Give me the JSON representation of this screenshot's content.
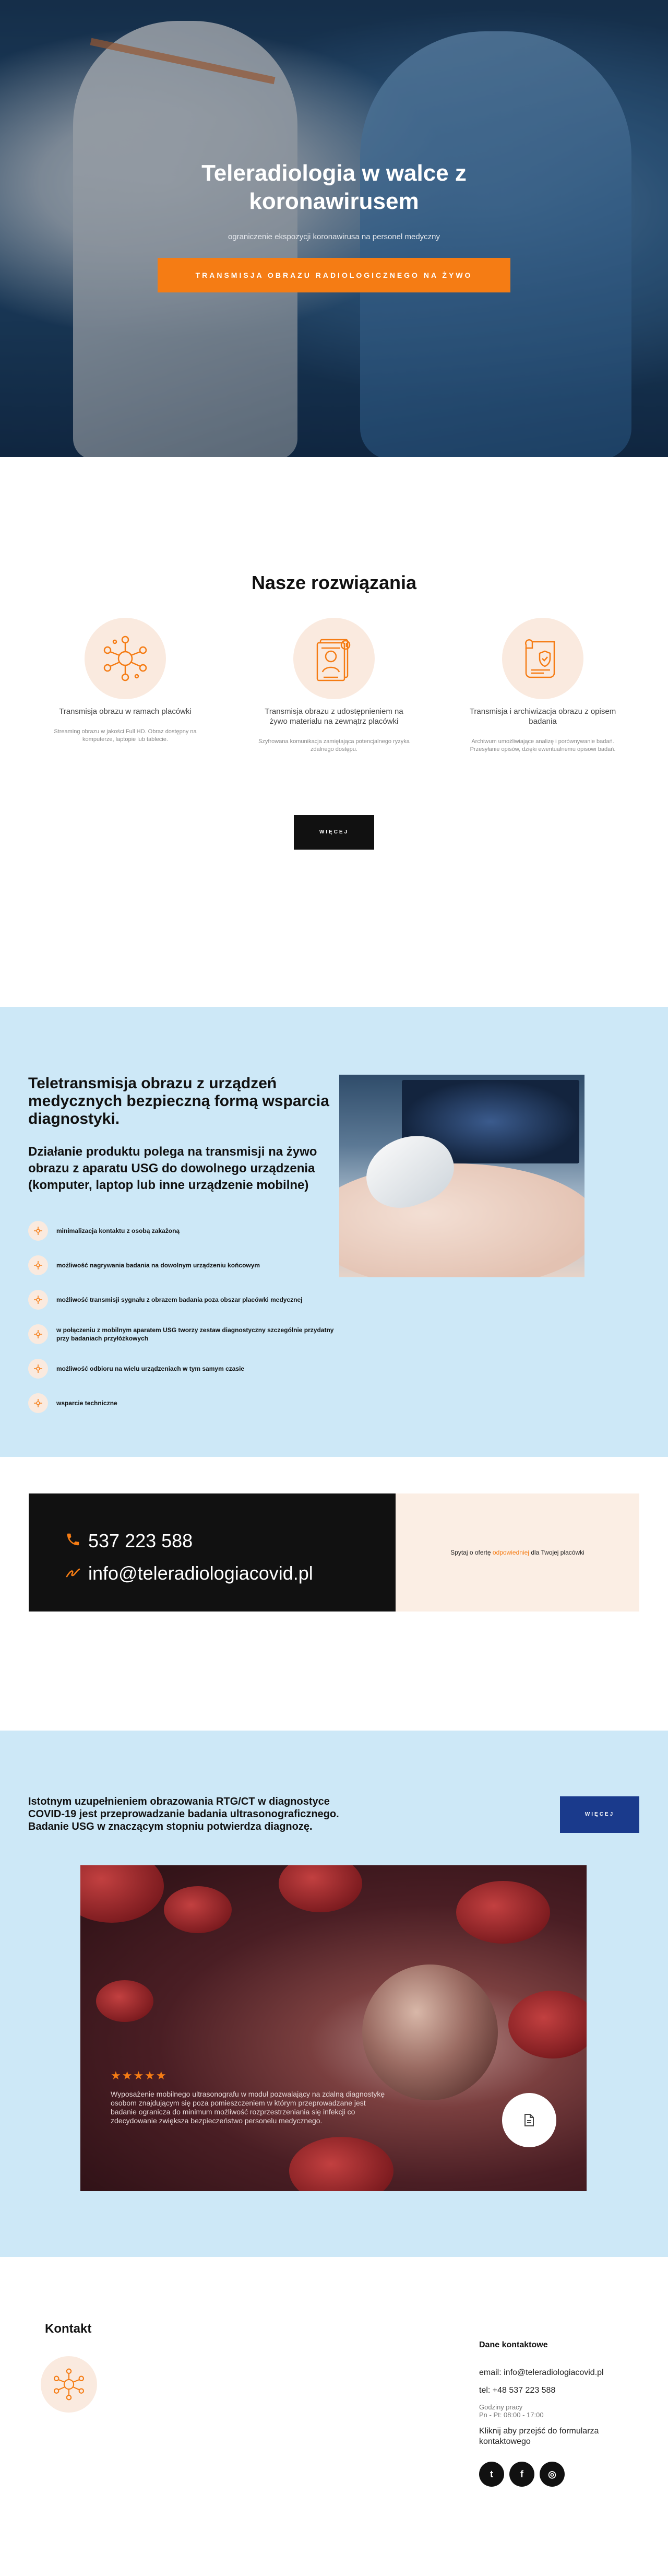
{
  "hero": {
    "title": "Teleradiologia w walce z koronawirusem",
    "subtitle": "ograniczenie ekspozycji koronawirusa na personel medyczny",
    "button_label": "TRANSMISJA OBRAZU RADIOLOGICZNEGO NA ŻYWO"
  },
  "solutions": {
    "title": "Nasze rozwiązania",
    "items": [
      {
        "label": "Transmisja obrazu w ramach placówki",
        "desc": "Streaming obrazu w jakości Full HD. Obraz dostępny na komputerze, laptopie lub tablecie.",
        "icon": "network-nodes-icon"
      },
      {
        "label": "Transmisja obrazu z udostępnieniem na żywo materiału na zewnątrz placówki",
        "desc": "Szyfrowana komunikacja zamiętająca potencjalnego ryzyka zdalnego dostępu.",
        "icon": "document-profile-icon"
      },
      {
        "label": "Transmisja i archiwizacja obrazu z opisem badania",
        "desc": "Archiwum umożliwiające analizę i porównywanie badań. Przesyłanie opisów, dzięki ewentualnemu opisowi badań.",
        "icon": "secure-archive-icon"
      }
    ],
    "more_label": "WIĘCEJ"
  },
  "tele": {
    "heading": "Teletransmisja obrazu z urządzeń medycznych bezpieczną formą wsparcia diagnostyki.",
    "paragraph": "Działanie produktu polega na transmisji na żywo obrazu z aparatu USG do dowolnego urządzenia (komputer, laptop lub inne urządzenie mobilne)",
    "list": [
      "minimalizacja kontaktu z osobą zakażoną",
      "możliwość nagrywania badania na dowolnym urządzeniu końcowym",
      "możliwość transmisji sygnału z obrazem badania poza obszar placówki medycznej",
      "w połączeniu z mobilnym aparatem USG tworzy zestaw diagnostyczny szczególnie przydatny przy badaniach przyłóżkowych",
      "możliwość odbioru na wielu urządzeniach w tym samym czasie",
      "wsparcie techniczne"
    ]
  },
  "contact_strip": {
    "phone": "537 223 588",
    "email": "info@teleradiologiacovid.pl",
    "ask_prefix": "Spytaj o ofertę",
    "ask_accent": "odpowiedniej",
    "ask_suffix": "dla Twojej placówki"
  },
  "usg": {
    "text": "Istotnym uzupełnieniem obrazowania RTG/CT w diagnostyce COVID-19 jest przeprowadzanie badania ultrasonograficznego. Badanie USG w znaczącym stopniu potwierdza diagnozę.",
    "button_label": "WIĘCEJ",
    "stars": "★★★★★",
    "rating": 5,
    "card_text": "Wyposażenie mobilnego ultrasonografu w moduł pozwalający na zdalną diagnostykę osobom znajdującym się poza pomieszczeniem w którym przeprowadzane jest badanie ogranicza do minimum możliwość rozprzestrzeniania się infekcji co zdecydowanie zwiększa bezpieczeństwo personelu medycznego."
  },
  "footer": {
    "title": "Kontakt",
    "contact_heading": "Dane kontaktowe",
    "email_line": "email: info@teleradiologiacovid.pl",
    "phone_line": "tel: +48 537 223 588",
    "hours_label": "Godziny pracy",
    "hours": "Pn - Pt: 08:00 - 17:00",
    "form_link": "Kliknij aby przejść do formularza kontaktowego",
    "socials": [
      {
        "name": "twitter",
        "glyph": "t"
      },
      {
        "name": "facebook",
        "glyph": "f"
      },
      {
        "name": "instagram",
        "glyph": "◎"
      }
    ]
  },
  "colors": {
    "accent": "#f57c14",
    "light_blue": "#cde8f7",
    "peach": "#faeadf",
    "navy_button": "#1a3a8c"
  }
}
